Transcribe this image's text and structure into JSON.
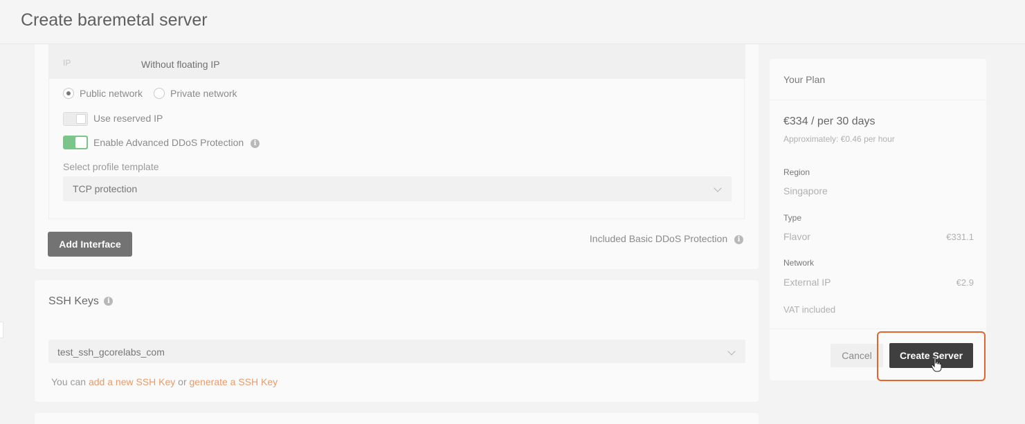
{
  "page": {
    "title": "Create baremetal server"
  },
  "interface": {
    "ip_label": "IP",
    "ip_value": "Without floating IP",
    "network_options": [
      {
        "label": "Public network",
        "selected": true
      },
      {
        "label": "Private network",
        "selected": false
      }
    ],
    "reserved_ip": {
      "label": "Use reserved IP",
      "enabled": false
    },
    "ddos": {
      "label": "Enable Advanced DDoS Protection",
      "enabled": true
    },
    "profile_template": {
      "label": "Select profile template",
      "value": "TCP protection"
    },
    "add_interface_label": "Add Interface",
    "basic_ddos_label": "Included Basic DDoS Protection"
  },
  "ssh": {
    "title": "SSH Keys",
    "selected_key": "test_ssh_gcorelabs_com",
    "hint_prefix": "You can ",
    "hint_link1": "add a new SSH Key",
    "hint_mid": " or ",
    "hint_link2": "generate a SSH Key"
  },
  "plan": {
    "title": "Your Plan",
    "price": "€334 / per 30 days",
    "approx": "Approximately: €0.46 per hour",
    "region_label": "Region",
    "region_value": "Singapore",
    "type_label": "Type",
    "flavor_label": "Flavor",
    "flavor_price": "€331.1",
    "network_label": "Network",
    "external_ip_label": "External IP",
    "external_ip_price": "€2.9",
    "vat": "VAT included",
    "cancel_label": "Cancel",
    "create_label": "Create Server"
  },
  "colors": {
    "accent": "#e8632a",
    "toggle_on": "#7cc58a",
    "link": "#e89b6a",
    "primary_button": "#3f3f3f"
  },
  "icons": [
    "info-icon",
    "chevron-down-icon",
    "pointer-cursor-icon"
  ]
}
